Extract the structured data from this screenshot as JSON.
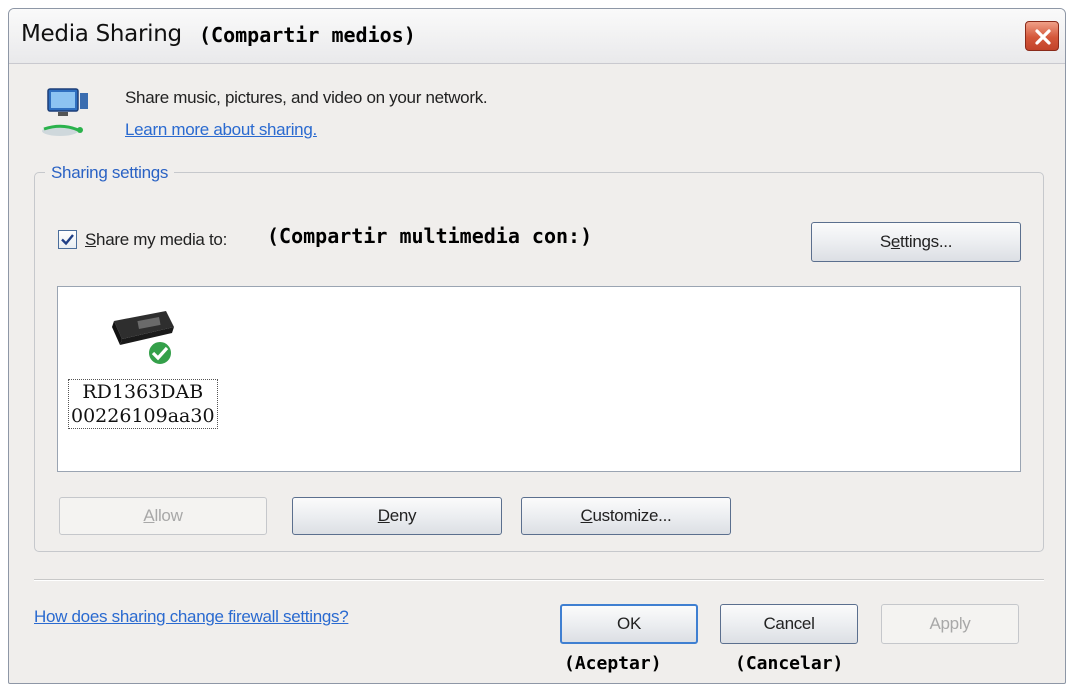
{
  "window": {
    "title": "Media Sharing",
    "title_annotation": "(Compartir medios)"
  },
  "header": {
    "icon": "network-media-icon",
    "description": "Share music, pictures, and video on your network.",
    "learn_more_link": "Learn more about sharing."
  },
  "sharing_settings": {
    "group_title": "Sharing settings",
    "share_checkbox": {
      "checked": true,
      "label_accel": "S",
      "label_rest": "hare my media to:",
      "annotation": "(Compartir multimedia con:)"
    },
    "settings_button": {
      "accel": "e",
      "pre": "S",
      "post": "ttings..."
    },
    "devices": [
      {
        "icon": "media-device-allowed-icon",
        "name_line1": "RD1363DAB",
        "name_line2": "00226109aa30"
      }
    ],
    "allow_button": {
      "accel": "A",
      "rest": "llow",
      "enabled": false
    },
    "deny_button": {
      "accel": "D",
      "rest": "eny"
    },
    "customize_button": {
      "accel": "C",
      "rest": "ustomize..."
    }
  },
  "footer": {
    "firewall_link": "How does sharing change firewall settings?",
    "ok_button": "OK",
    "cancel_button": "Cancel",
    "apply_button": "Apply",
    "apply_enabled": false,
    "ok_annotation": "(Aceptar)",
    "cancel_annotation": "(Cancelar)"
  },
  "colors": {
    "link": "#2a6ad0",
    "group_title": "#2a62c4",
    "close_button": "#d4573a",
    "window_bg": "#f0eeec"
  }
}
